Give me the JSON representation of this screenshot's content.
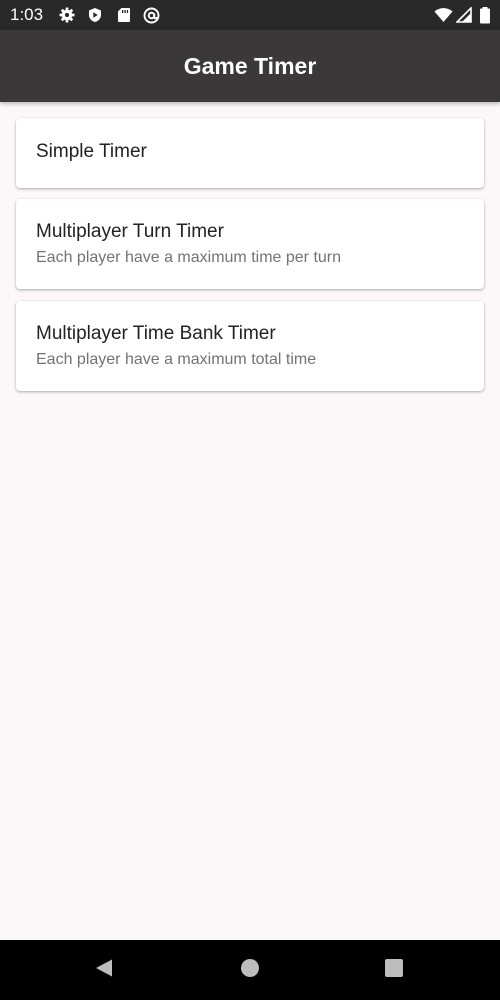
{
  "status_bar": {
    "time": "1:03",
    "left_icons": [
      "gear-icon",
      "shield-icon",
      "sd-card-icon",
      "at-sign-icon"
    ],
    "right_icons": [
      "wifi-icon",
      "signal-icon",
      "battery-icon"
    ]
  },
  "app_bar": {
    "title": "Game Timer"
  },
  "timers": [
    {
      "title": "Simple Timer"
    },
    {
      "title": "Multiplayer Turn Timer",
      "subtitle": "Each player have a maximum time per turn"
    },
    {
      "title": "Multiplayer Time Bank Timer",
      "subtitle": "Each player have a maximum total time"
    }
  ],
  "nav_bar": {
    "buttons": [
      "back-icon",
      "home-icon",
      "recents-icon"
    ]
  },
  "colors": {
    "status_bar_bg": "#2a2929",
    "app_bar_bg": "#3a3839",
    "page_bg": "#fcf8fa",
    "card_bg": "#ffffff",
    "title_text": "#222222",
    "subtitle_text": "#737373",
    "nav_bar_bg": "#000000"
  }
}
